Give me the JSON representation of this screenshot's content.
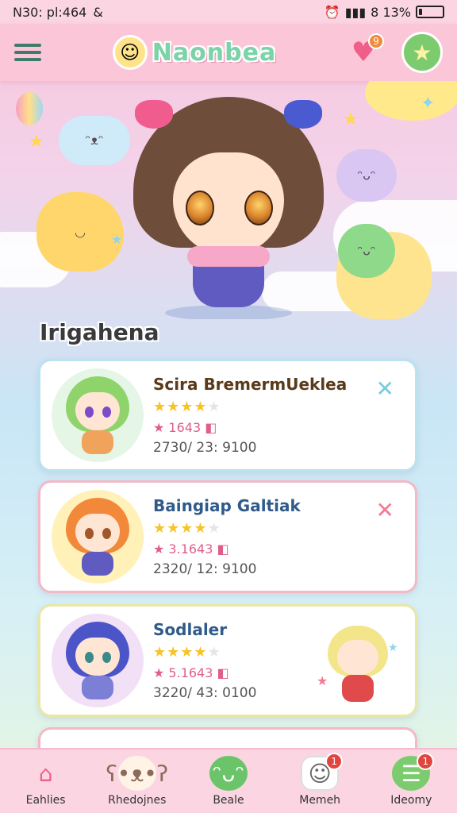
{
  "status_bar": {
    "time": "N30: pl:464",
    "extra": "&",
    "battery_text": "8 13%",
    "battery_level": 0.13
  },
  "header": {
    "app_name": "Naonbea",
    "heart_badge": "9"
  },
  "section": {
    "title": "Irigahena"
  },
  "cards": [
    {
      "name": "Scira BremermUeklea",
      "stars": 4,
      "sub": "★ 1643 ◧",
      "meta": "2730/  23:  9100",
      "close": "✕"
    },
    {
      "name": "Baingiap Galtiak",
      "stars": 4,
      "sub": "★ 3.1643 ◧",
      "meta": "2320/  12:  9100",
      "close": "✕"
    },
    {
      "name": "Sodlaler",
      "stars": 4,
      "sub": "★ 5.1643 ◧",
      "meta": "3220/  43:  0100"
    }
  ],
  "nav": [
    {
      "label": "Eahlies",
      "icon": "home-icon",
      "color": "#ef5f89"
    },
    {
      "label": "Rhedojnes",
      "icon": "bear-icon",
      "color": "#8c6a5a"
    },
    {
      "label": "Beale",
      "icon": "blob-icon",
      "color": "#4aa84a"
    },
    {
      "label": "Memeh",
      "icon": "ghost-icon",
      "color": "#666",
      "badge": "1"
    },
    {
      "label": "Ideomy",
      "icon": "menu-icon",
      "color": "#3f9a5a",
      "badge": "1"
    }
  ],
  "colors": {
    "pink": "#fbc7d8",
    "card_blue_border": "#b8e3ef",
    "card_pink_border": "#f3b9c7",
    "card_yellow_border": "#e9e7a6"
  }
}
